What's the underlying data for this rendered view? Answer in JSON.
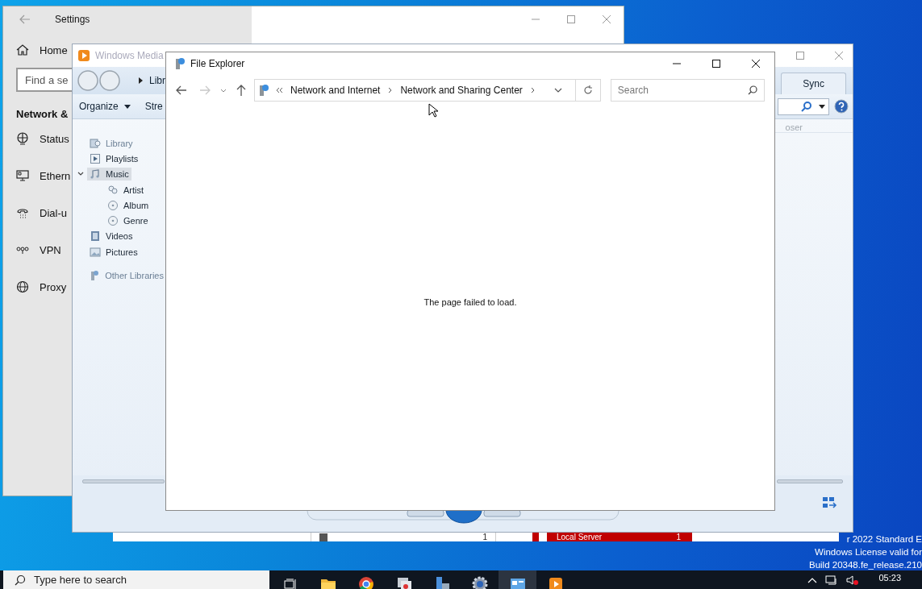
{
  "settings_window": {
    "title": "Settings",
    "home": "Home",
    "search": {
      "placeholder": "Find a se"
    },
    "section": "Network &",
    "items": [
      {
        "label": "Status",
        "kind": "status"
      },
      {
        "label": "Ethern",
        "kind": "ethernet"
      },
      {
        "label": "Dial-u",
        "kind": "dialup"
      },
      {
        "label": "VPN",
        "kind": "vpn"
      },
      {
        "label": "Proxy",
        "kind": "proxy"
      }
    ]
  },
  "server_manager": {
    "tiles": [
      {
        "kind": "plain",
        "count": "1"
      },
      {
        "kind": "alert",
        "label": "Local Server",
        "count": "1"
      }
    ]
  },
  "media_player": {
    "title": "Windows Media",
    "breadcrumb": "Libr",
    "toolbar": [
      "Organize",
      "Stre"
    ],
    "tabs": [
      {
        "label": "Sync",
        "selected": false
      }
    ],
    "column_header": "oser",
    "tree": [
      {
        "label": "Library",
        "kind": "library",
        "selected": false,
        "dimmed": true
      },
      {
        "label": "Playlists",
        "kind": "playlist",
        "selected": false,
        "dimmed": false
      },
      {
        "label": "Music",
        "kind": "music",
        "selected": true,
        "dimmed": false,
        "expanded": true,
        "children": [
          {
            "label": "Artist",
            "kind": "artist",
            "selected": false,
            "dimmed": false
          },
          {
            "label": "Album",
            "kind": "album",
            "selected": false,
            "dimmed": false
          },
          {
            "label": "Genre",
            "kind": "genre",
            "selected": false,
            "dimmed": false
          }
        ]
      },
      {
        "label": "Videos",
        "kind": "video",
        "selected": false,
        "dimmed": false
      },
      {
        "label": "Pictures",
        "kind": "picture",
        "selected": false,
        "dimmed": false
      },
      {
        "label": "Other Libraries",
        "kind": "other",
        "selected": false,
        "dimmed": true
      }
    ]
  },
  "file_explorer": {
    "title": "File Explorer",
    "nav": [
      {
        "kind": "back",
        "disabled": false
      },
      {
        "kind": "forward",
        "disabled": true
      }
    ],
    "breadcrumb": [
      "Network and Internet",
      "Network and Sharing Center"
    ],
    "search": {
      "placeholder": "Search"
    },
    "message": "The page failed to load."
  },
  "desktop": {
    "watermark": [
      "r 2022 Standard E",
      "Windows License valid for",
      "Build 20348.fe_release.210"
    ]
  },
  "taskbar": {
    "search": {
      "placeholder": "Type here to search"
    },
    "apps": [
      {
        "kind": "task-view",
        "active": false
      },
      {
        "kind": "folder",
        "active": false
      },
      {
        "kind": "chrome",
        "active": false
      },
      {
        "kind": "remote",
        "active": false
      },
      {
        "kind": "server",
        "active": false
      },
      {
        "kind": "gear",
        "active": false
      },
      {
        "kind": "network",
        "active": true
      },
      {
        "kind": "media",
        "active": false
      }
    ],
    "clock": "05:23"
  }
}
